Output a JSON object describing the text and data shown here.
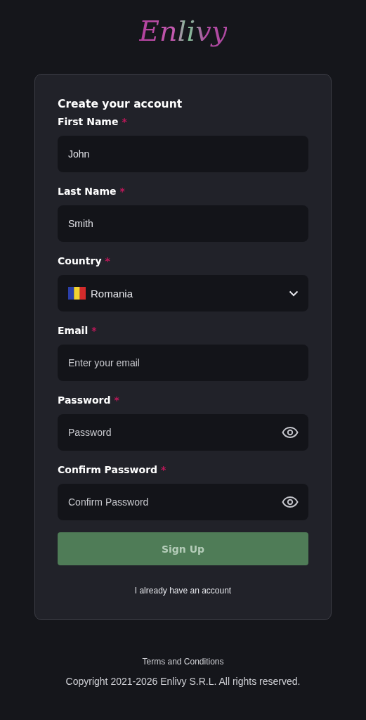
{
  "logo": {
    "text": "Enlivy"
  },
  "form": {
    "title": "Create your account",
    "fields": [
      {
        "kind": "text",
        "label": "First Name",
        "required_mark": "*",
        "value": "John"
      },
      {
        "kind": "text",
        "label": "Last Name",
        "required_mark": "*",
        "value": "Smith"
      },
      {
        "kind": "select",
        "label": "Country",
        "required_mark": "*",
        "value": "Romania"
      },
      {
        "kind": "text",
        "label": "Email",
        "required_mark": "*",
        "placeholder": "Enter your email"
      },
      {
        "kind": "password",
        "label": "Password",
        "required_mark": "*",
        "placeholder": "Password"
      },
      {
        "kind": "password",
        "label": "Confirm Password",
        "required_mark": "*",
        "placeholder": "Confirm Password"
      }
    ],
    "submit": {
      "label": "Sign Up",
      "disabled": true
    },
    "login_link": "I already have an account"
  },
  "footer": {
    "terms": "Terms and Conditions",
    "copyright": "Copyright 2021-2026 Enlivy S.R.L. All rights reserved."
  }
}
